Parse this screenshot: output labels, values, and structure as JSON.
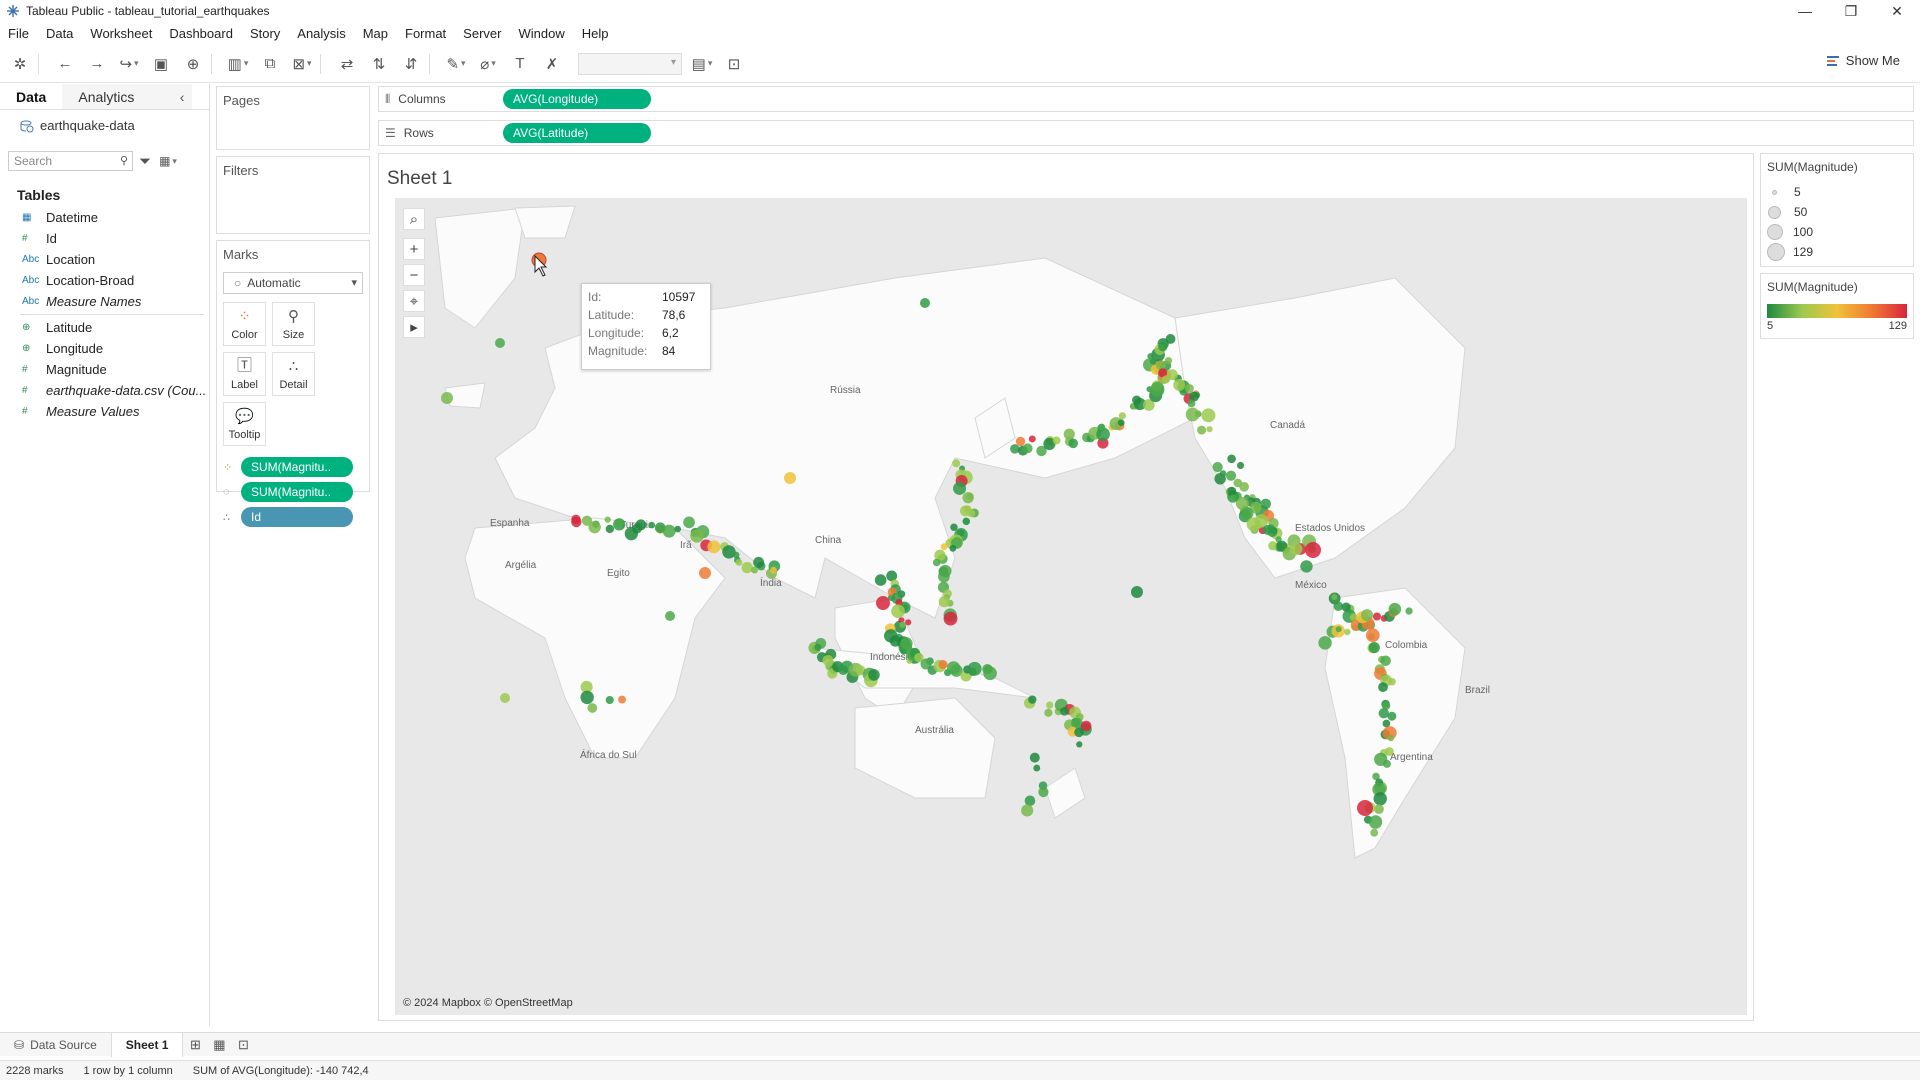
{
  "window": {
    "title": "Tableau Public - tableau_tutorial_earthquakes"
  },
  "menu": [
    "File",
    "Data",
    "Worksheet",
    "Dashboard",
    "Story",
    "Analysis",
    "Map",
    "Format",
    "Server",
    "Window",
    "Help"
  ],
  "toolbar": {
    "show_me": "Show Me"
  },
  "left_panel": {
    "tab_data": "Data",
    "tab_analytics": "Analytics",
    "datasource": "earthquake-data",
    "search_placeholder": "Search",
    "tables_title": "Tables",
    "fields": [
      {
        "icon": "calendar",
        "name": "Datetime",
        "italic": false
      },
      {
        "icon": "#",
        "name": "Id",
        "italic": false
      },
      {
        "icon": "Abc",
        "name": "Location",
        "italic": false
      },
      {
        "icon": "Abc",
        "name": "Location-Broad",
        "italic": false
      },
      {
        "icon": "Abc",
        "name": "Measure Names",
        "italic": true
      },
      {
        "icon": "globe",
        "name": "Latitude",
        "italic": false
      },
      {
        "icon": "globe",
        "name": "Longitude",
        "italic": false
      },
      {
        "icon": "#",
        "name": "Magnitude",
        "italic": false
      },
      {
        "icon": "#",
        "name": "earthquake-data.csv (Cou...",
        "italic": true
      },
      {
        "icon": "#",
        "name": "Measure Values",
        "italic": true
      }
    ]
  },
  "cards": {
    "pages": "Pages",
    "filters": "Filters",
    "marks": "Marks",
    "mark_type": "Automatic",
    "buttons": [
      "Color",
      "Size",
      "Label",
      "Detail",
      "Tooltip"
    ],
    "pills": [
      "SUM(Magnitu..",
      "SUM(Magnitu..",
      "Id"
    ]
  },
  "shelves": {
    "columns_label": "Columns",
    "columns_pill": "AVG(Longitude)",
    "rows_label": "Rows",
    "rows_pill": "AVG(Latitude)"
  },
  "sheet": {
    "title": "Sheet 1",
    "attribution": "© 2024 Mapbox © OpenStreetMap",
    "map_labels": [
      "Rússia",
      "Canadá",
      "Estados Unidos",
      "México",
      "Colombia",
      "Brazil",
      "Argentina",
      "China",
      "Índia",
      "Irã",
      "Turquia",
      "Egito",
      "Argélia",
      "Espanha",
      "Austrália",
      "Indonésia",
      "África do Sul"
    ]
  },
  "tooltip": {
    "rows": [
      {
        "key": "Id:",
        "value": "10597"
      },
      {
        "key": "Latitude:",
        "value": "78,6"
      },
      {
        "key": "Longitude:",
        "value": "6,2"
      },
      {
        "key": "Magnitude:",
        "value": "84"
      }
    ]
  },
  "legends": {
    "size_title": "SUM(Magnitude)",
    "size_items": [
      "5",
      "50",
      "100",
      "129"
    ],
    "color_title": "SUM(Magnitude)",
    "color_min": "5",
    "color_max": "129",
    "colors": {
      "low": "#1e8a3e",
      "mid": "#f0c23a",
      "high": "#d7263d"
    }
  },
  "bottom": {
    "data_source_tab": "Data Source",
    "sheet_tab": "Sheet 1"
  },
  "status": {
    "marks": "2228 marks",
    "layout": "1 row by 1 column",
    "sum": "SUM of AVG(Longitude): -140 742,4"
  }
}
